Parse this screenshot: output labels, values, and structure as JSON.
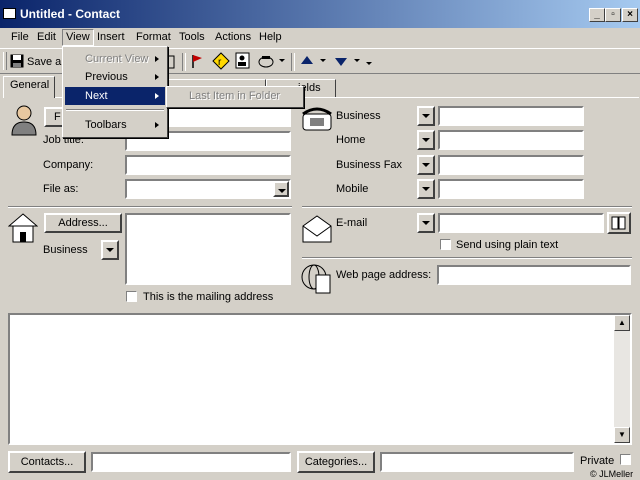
{
  "window": {
    "title": "Untitled - Contact"
  },
  "menubar": [
    "File",
    "Edit",
    "View",
    "Insert",
    "Format",
    "Tools",
    "Actions",
    "Help"
  ],
  "toolbar": {
    "save_label": "Save a"
  },
  "tabs": {
    "general": "General",
    "fields": "ields"
  },
  "view_menu": {
    "items": [
      {
        "label": "Current View",
        "disabled": true
      },
      {
        "label": "Previous",
        "disabled": false
      },
      {
        "label": "Next",
        "disabled": false,
        "highlighted": true
      },
      {
        "label": "Toolbars",
        "disabled": false
      }
    ],
    "next_submenu": "Last Item in Folder"
  },
  "left": {
    "fullname_button": "F",
    "job_title": "Job title:",
    "company": "Company:",
    "file_as": "File as:",
    "address_button": "Address...",
    "address_type": "Business",
    "mailing_checkbox": "This is the mailing address"
  },
  "phones": [
    "Business",
    "Home",
    "Business Fax",
    "Mobile"
  ],
  "email": {
    "label": "E-mail",
    "plain_text": "Send using plain text"
  },
  "web": {
    "label": "Web page address:"
  },
  "bottom": {
    "contacts_button": "Contacts...",
    "categories_button": "Categories...",
    "private_label": "Private"
  },
  "watermark": "© JLMeller"
}
